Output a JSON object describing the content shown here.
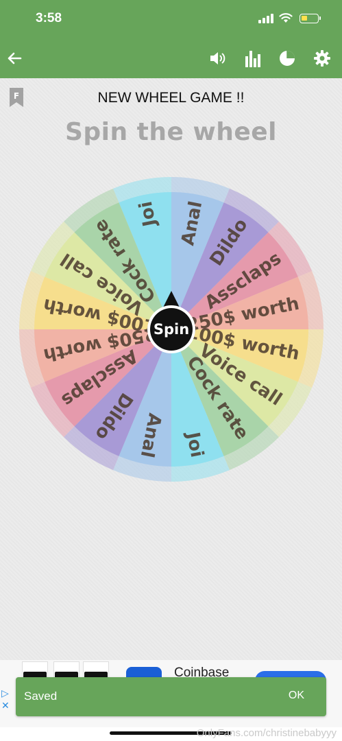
{
  "status_bar": {
    "time": "3:58"
  },
  "header": {
    "icons": [
      "back-arrow-icon",
      "volume-icon",
      "bar-chart-icon",
      "pie-chart-icon",
      "gear-icon"
    ]
  },
  "game": {
    "title": "NEW WHEEL GAME !!",
    "heading": "Spin the wheel",
    "spin_label": "Spin"
  },
  "wheel": {
    "segments": [
      {
        "label": "Joi",
        "color": "#8fe0ef"
      },
      {
        "label": "Anal",
        "color": "#a6c7ea"
      },
      {
        "label": "Dildo",
        "color": "#a89ad6"
      },
      {
        "label": "Assclaps",
        "color": "#e59aac"
      },
      {
        "label": "250$ worth",
        "color": "#f1b3a6"
      },
      {
        "label": "100$ worth",
        "color": "#f6de8d"
      },
      {
        "label": "Voice call",
        "color": "#dde8a5"
      },
      {
        "label": "Cock rate",
        "color": "#a9d4a9"
      },
      {
        "label": "Joi",
        "color": "#8fe0ef"
      },
      {
        "label": "Anal",
        "color": "#a6c7ea"
      },
      {
        "label": "Dildo",
        "color": "#a89ad6"
      },
      {
        "label": "Assclaps",
        "color": "#e59aac"
      },
      {
        "label": "250$ worth",
        "color": "#f1b3a6"
      },
      {
        "label": "100$ worth",
        "color": "#f6de8d"
      },
      {
        "label": "Voice call",
        "color": "#dde8a5"
      },
      {
        "label": "Cock rate",
        "color": "#a9d4a9"
      }
    ]
  },
  "ad": {
    "app_name": "Coinbase"
  },
  "snackbar": {
    "message": "Saved",
    "action": "OK"
  },
  "watermark": "OnlyFans.com/christinebabyyy",
  "colors": {
    "primary": "#67a55a",
    "heading": "#a7a7a7",
    "wheel_text": "#4c3b2e"
  }
}
